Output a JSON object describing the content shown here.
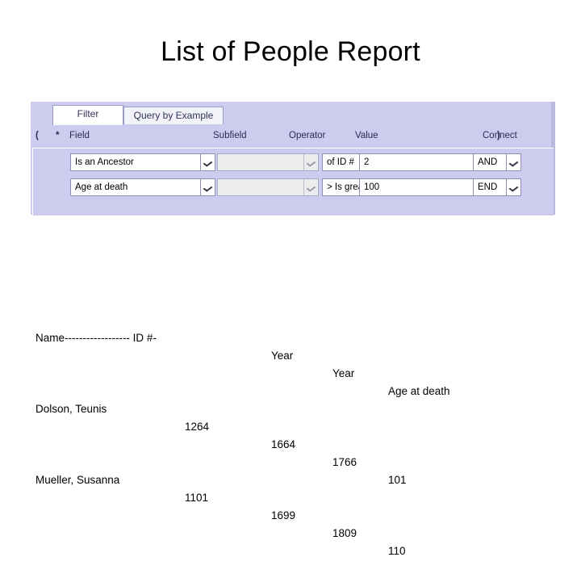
{
  "slide": {
    "title": "List of People Report"
  },
  "filter_panel": {
    "tabs": [
      {
        "label": "Filter",
        "selected": true
      },
      {
        "label": "Query by Example",
        "selected": false
      }
    ],
    "column_headers": {
      "paren_open": "(",
      "star": "*",
      "field": "Field",
      "subfield": "Subfield",
      "operator": "Operator",
      "value": "Value",
      "paren_close": ")",
      "connect": "Connect"
    },
    "rows": [
      {
        "field": "Is an Ancestor",
        "subfield": "",
        "operator": "of ID #",
        "value": "2",
        "value_picker_icon": "binoculars-icon",
        "connect": "AND"
      },
      {
        "field": "Age at death",
        "subfield": "",
        "operator": ">   Is grea",
        "value": "100",
        "value_picker_icon": "",
        "connect": "END"
      }
    ],
    "colors": {
      "panel_background": "#ccccee",
      "tab_active_background": "#ffffff",
      "tab_inactive_background": "#f2f2f9",
      "control_border": "#8f8fb5",
      "disabled_field": "#ececec"
    }
  },
  "report": {
    "header": {
      "name": "Name------------------ ID #-",
      "year1": "Year",
      "year2": "Year",
      "age": "Age at death"
    },
    "rows": [
      {
        "name": "Dolson, Teunis",
        "id": "1264",
        "year1": "1664",
        "year2": "1766",
        "age": "101"
      },
      {
        "name": "Mueller, Susanna",
        "id": "1101",
        "year1": "1699",
        "year2": "1809",
        "age": "110"
      }
    ]
  }
}
